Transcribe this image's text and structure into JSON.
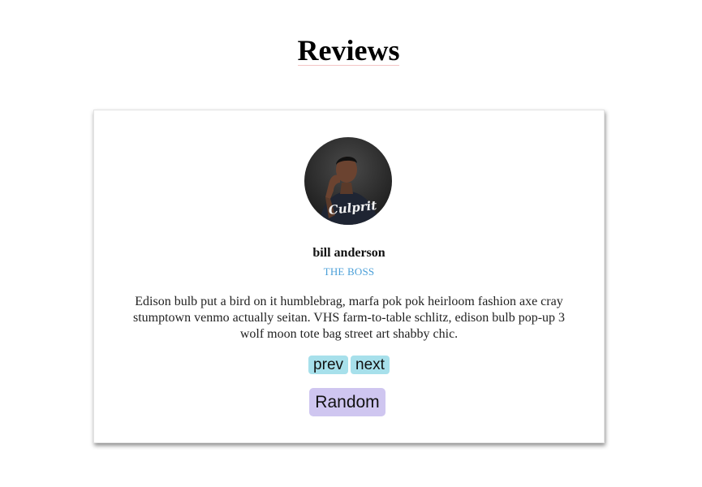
{
  "page": {
    "title": "Reviews"
  },
  "review": {
    "avatar_alt": "bill anderson",
    "name": "bill anderson",
    "job": "THE BOSS",
    "text": "Edison bulb put a bird on it humblebrag, marfa pok pok heirloom fashion axe cray stumptown venmo actually seitan. VHS farm-to-table schlitz, edison bulb pop-up 3 wolf moon tote bag street art shabby chic.",
    "shirt_text": "Culprit"
  },
  "buttons": {
    "prev": "prev",
    "next": "next",
    "random": "Random"
  },
  "colors": {
    "job": "#4a9fd8",
    "nav_button_bg": "#a7e0eb",
    "random_button_bg": "#cfc6f0",
    "title_underline": "#f3c4c4"
  }
}
